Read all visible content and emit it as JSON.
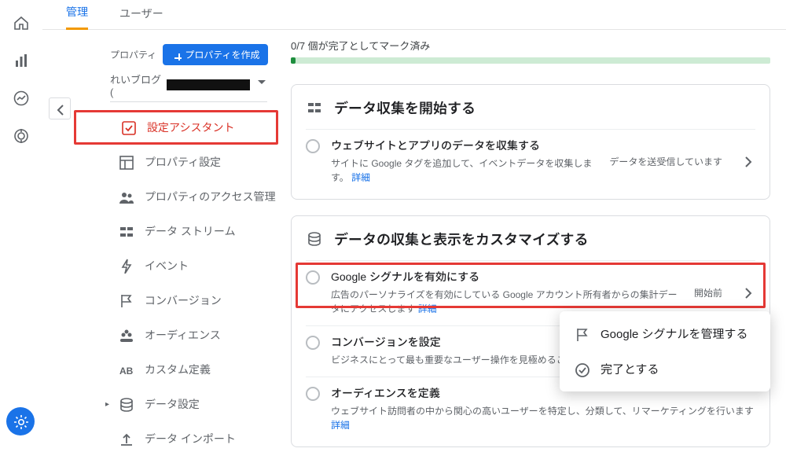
{
  "topnav": {
    "tabs": [
      "管理",
      "ユーザー"
    ],
    "active": 0
  },
  "property": {
    "label": "プロパティ",
    "create_btn": "プロパティを作成",
    "selected_prefix": "れいブログ ("
  },
  "sidebar": {
    "items": [
      {
        "label": "設定アシスタント",
        "icon": "check-square-icon",
        "active": true
      },
      {
        "label": "プロパティ設定",
        "icon": "layout-icon"
      },
      {
        "label": "プロパティのアクセス管理",
        "icon": "people-icon"
      },
      {
        "label": "データ ストリーム",
        "icon": "stream-icon"
      },
      {
        "label": "イベント",
        "icon": "bolt-icon"
      },
      {
        "label": "コンバージョン",
        "icon": "flag-icon"
      },
      {
        "label": "オーディエンス",
        "icon": "audience-icon"
      },
      {
        "label": "カスタム定義",
        "icon": "abc-icon"
      },
      {
        "label": "データ設定",
        "icon": "database-icon",
        "expandable": true
      },
      {
        "label": "データ インポート",
        "icon": "upload-icon"
      }
    ]
  },
  "progress": {
    "text": "0/7 個が完了としてマーク済み"
  },
  "cards": [
    {
      "title": "データ収集を開始する",
      "icon": "stream-icon",
      "rows": [
        {
          "title": "ウェブサイトとアプリのデータを収集する",
          "desc": "サイトに Google タグを追加して、イベントデータを収集します。",
          "link": "詳細",
          "status": "データを送受信しています"
        }
      ]
    },
    {
      "title": "データの収集と表示をカスタマイズする",
      "icon": "database-icon",
      "rows": [
        {
          "title": "Google シグナルを有効にする",
          "desc": "広告のパーソナライズを有効にしている Google アカウント所有者からの集計データにアクセスします",
          "link": "詳細",
          "status": "開始前",
          "highlight": true
        },
        {
          "title": "コンバージョンを設定",
          "desc": "ビジネスにとって最も重要なユーザー操作を見極めること"
        },
        {
          "title": "オーディエンスを定義",
          "desc": "ウェブサイト訪問者の中から関心の高いユーザーを特定し、分類して、リマーケティングを行います",
          "link": "詳細"
        }
      ]
    }
  ],
  "menu": {
    "items": [
      {
        "label": "Google シグナルを管理する",
        "icon": "flag-icon"
      },
      {
        "label": "完了とする",
        "icon": "check-circle-icon"
      }
    ]
  }
}
